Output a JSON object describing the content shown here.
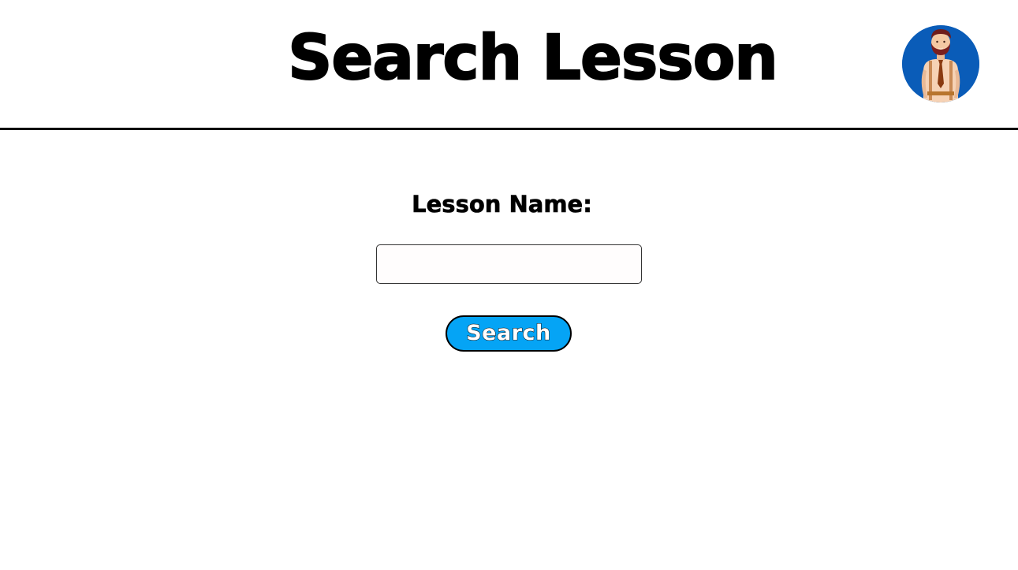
{
  "header": {
    "title": "Search Lesson",
    "avatar_icon": "user-avatar-icon"
  },
  "form": {
    "label": "Lesson Name:",
    "input_value": "",
    "input_placeholder": "",
    "button_label": "Search"
  },
  "colors": {
    "button_background": "#05a4f5",
    "avatar_background": "#0a5cb8",
    "divider": "#000000",
    "text": "#000000"
  }
}
